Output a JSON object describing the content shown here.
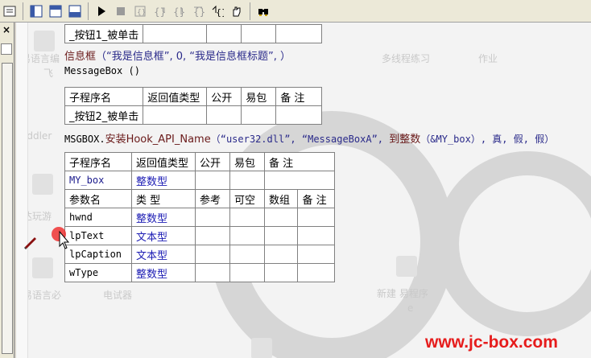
{
  "toolbar": {
    "icons": [
      "view-icon",
      "layout-icon-1",
      "layout-icon-2",
      "layout-icon-3",
      "run-icon",
      "stop-icon",
      "step-icon-1",
      "step-icon-2",
      "step-icon-3",
      "step-icon-4",
      "step-icon-5",
      "hand-icon",
      "find-icon"
    ]
  },
  "left_panel": {
    "close": "×"
  },
  "editor": {
    "top_table": {
      "name": "_按钮1_被单击"
    },
    "line_messagebox": {
      "fn": "信息框",
      "args_prefix": "（“我是信息框”, 0, “我是信息框标题”, ）"
    },
    "line_messagebox2": "MessageBox ()",
    "table2": {
      "headers": [
        "子程序名",
        "返回值类型",
        "公开",
        "易包",
        "备 注"
      ],
      "name": "_按钮2_被单击"
    },
    "line_hook": {
      "prefix": "MSGBOX.",
      "fn": "安装Hook_API_Name",
      "arg1": "（“user32.dll”,",
      "arg2": "“MessageBoxA”,",
      "conv": "到整数",
      "arg3": "（&MY_box）, 真, 假, 假）"
    },
    "table3": {
      "headers": [
        "子程序名",
        "返回值类型",
        "公开",
        "易包",
        "备 注"
      ],
      "name": "MY_box",
      "return_type": "整数型",
      "param_headers": [
        "参数名",
        "类 型",
        "参考",
        "可空",
        "数组",
        "备 注"
      ],
      "params": [
        {
          "name": "hwnd",
          "type": "整数型"
        },
        {
          "name": "lpText",
          "type": "文本型"
        },
        {
          "name": "lpCaption",
          "type": "文本型"
        },
        {
          "name": "wType",
          "type": "整数型"
        }
      ]
    }
  },
  "watermark": {
    "labels": [
      "易语言编",
      "飞",
      "Fiddler",
      "达玩游",
      "易语言必",
      "电试器",
      "多线程练习",
      "作业",
      "新建 易程序",
      "e"
    ],
    "brand": "www.jc-box.com"
  },
  "colors": {
    "brand": "#e61c1c",
    "type_blue": "#1c1cb4"
  }
}
